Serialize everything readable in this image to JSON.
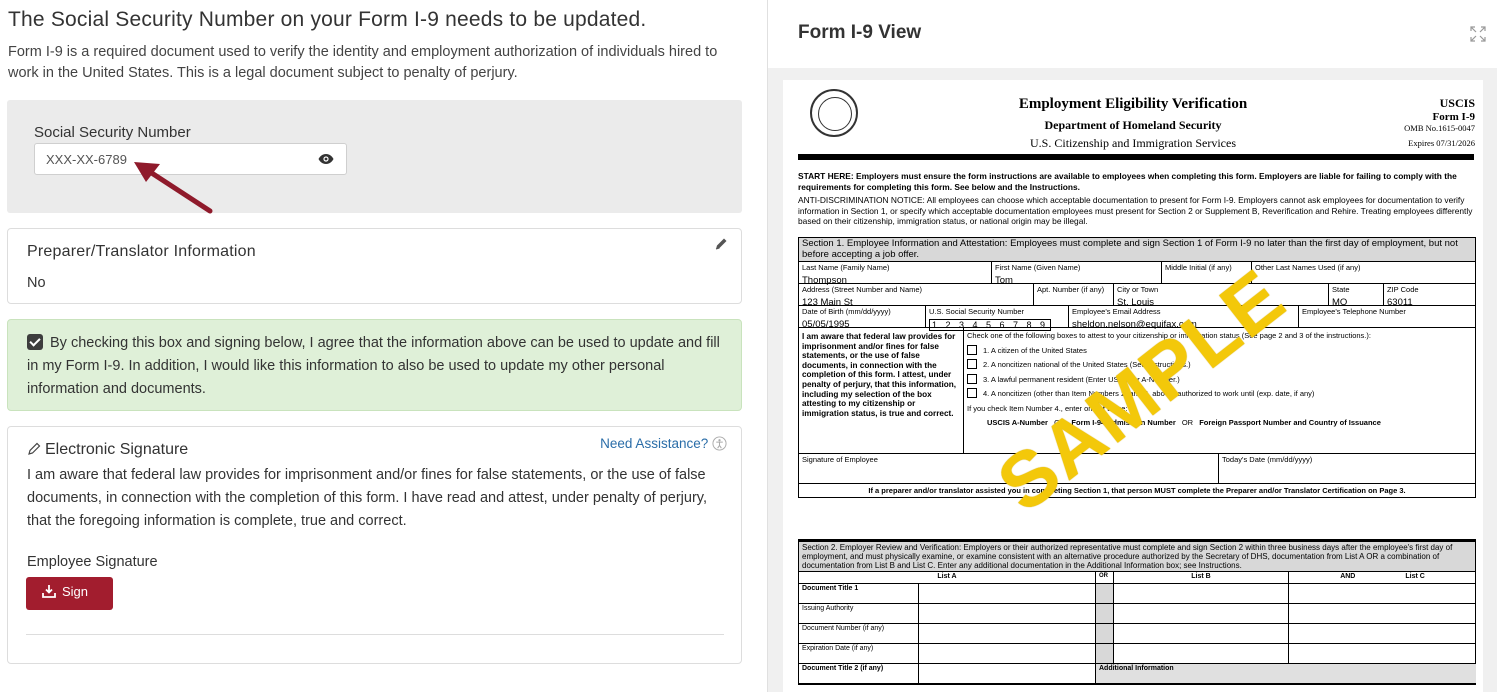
{
  "left": {
    "heading": "The Social Security Number on your Form I-9 needs to be updated.",
    "intro": "Form I-9 is a required document used to verify the identity and employment authorization of individuals hired to work in the United States. This is a legal document subject to penalty of perjury.",
    "ssn": {
      "label": "Social Security Number",
      "value": "XXX-XX-6789"
    },
    "preparer": {
      "title": "Preparer/Translator Information",
      "value": "No"
    },
    "agree_text": "By checking this box and signing below, I agree that the information above can be used to update and fill in my Form I-9. In addition, I would like this information to also be used to update my other personal information and documents.",
    "signature": {
      "title": "Electronic Signature",
      "need_assistance": "Need Assistance?",
      "body": "I am aware that federal law provides for imprisonment and/or fines for false statements, or the use of false documents, in connection with the completion of this form. I have read and attest, under penalty of perjury, that the foregoing information is complete, true and correct.",
      "employee_label": "Employee Signature",
      "sign_button": "Sign"
    }
  },
  "right": {
    "title": "Form I-9 View",
    "form": {
      "title": "Employment Eligibility Verification",
      "dept": "Department of Homeland Security",
      "agency": "U.S. Citizenship and Immigration Services",
      "uscis": "USCIS",
      "form_no": "Form I-9",
      "omb": "OMB No.1615-0047",
      "expires": "Expires 07/31/2026",
      "start_here": "START HERE: Employers must ensure the form instructions are available to employees when completing this form. Employers are liable for failing to comply with the requirements for completing this form. See below and the Instructions.",
      "anti_disc": "ANTI-DISCRIMINATION NOTICE: All employees can choose which acceptable documentation to present for Form I-9. Employers cannot ask employees for documentation to verify information in Section 1, or specify which acceptable documentation employees must present for Section 2 or Supplement B, Reverification and Rehire. Treating employees differently based on their citizenship, immigration status, or national origin may be illegal.",
      "sec1_header": "Section 1. Employee Information and Attestation: Employees must complete and sign Section 1 of Form I-9 no later than the first day of employment, but not before accepting a job offer.",
      "last_name_label": "Last Name (Family Name)",
      "last_name": "Thompson",
      "first_name_label": "First Name (Given Name)",
      "first_name": "Tom",
      "middle_label": "Middle Initial (if any)",
      "other_names_label": "Other Last Names Used (if any)",
      "address_label": "Address (Street Number and Name)",
      "address": "123 Main St",
      "apt_label": "Apt. Number (if any)",
      "city_label": "City or Town",
      "city": "St. Louis",
      "state_label": "State",
      "state": "MO",
      "zip_label": "ZIP Code",
      "zip": "63011",
      "dob_label": "Date of Birth (mm/dd/yyyy)",
      "dob": "05/05/1995",
      "ssn_label": "U.S. Social Security Number",
      "ssn_digits": "1 2 3 4 5 6 7 8 9",
      "email_label": "Employee's Email Address",
      "email": "sheldon.nelson@equifax.com",
      "phone_label": "Employee's Telephone Number",
      "attest_bold": "I am aware that federal law provides for imprisonment and/or fines for false statements, or the use of false documents, in connection with the completion of this form. I attest, under penalty of perjury, that this information, including my selection of the box attesting to my citizenship or immigration status, is true and correct.",
      "check_one": "Check one of the following boxes to attest to your citizenship or immigration status (See page 2 and 3 of the instructions.):",
      "opt1": "1. A citizen of the United States",
      "opt2": "2. A noncitizen national of the United States (See Instructions.)",
      "opt3": "3. A lawful permanent resident (Enter USCIS or A-Number.)",
      "opt4": "4. A noncitizen (other than Item Numbers 2. and 3. above) authorized to work until (exp. date, if any)",
      "if_check": "If you check Item Number 4., enter one of these:",
      "uscis_a": "USCIS A-Number",
      "i94": "Form I-94 Admission Number",
      "passport": "Foreign Passport Number and Country of Issuance",
      "or": "OR",
      "sig_emp": "Signature of Employee",
      "today": "Today's Date (mm/dd/yyyy)",
      "preparer_note": "If a preparer and/or translator assisted you in completing Section 1, that person MUST complete the Preparer and/or Translator Certification on Page 3.",
      "sec2_header": "Section 2. Employer Review and Verification: Employers or their authorized representative must complete and sign Section 2 within three business days after the employee's first day of employment, and must physically examine, or examine consistent with an alternative procedure authorized by the Secretary of DHS, documentation from List A OR a combination of documentation from List B and List C. Enter any additional documentation in the Additional Information box; see Instructions.",
      "list_a": "List A",
      "list_b": "List B",
      "and": "AND",
      "list_c": "List C",
      "doc_title1": "Document Title 1",
      "issuing": "Issuing Authority",
      "doc_number": "Document Number (if any)",
      "exp_date": "Expiration Date (if any)",
      "doc_title2": "Document Title 2 (if any)",
      "additional": "Additional Information",
      "watermark": "SAMPLE"
    }
  },
  "colors": {
    "sign_button": "#a21d2e",
    "agree_bg": "#dff0d8",
    "watermark": "#f3c80a",
    "link": "#2a6da8"
  }
}
